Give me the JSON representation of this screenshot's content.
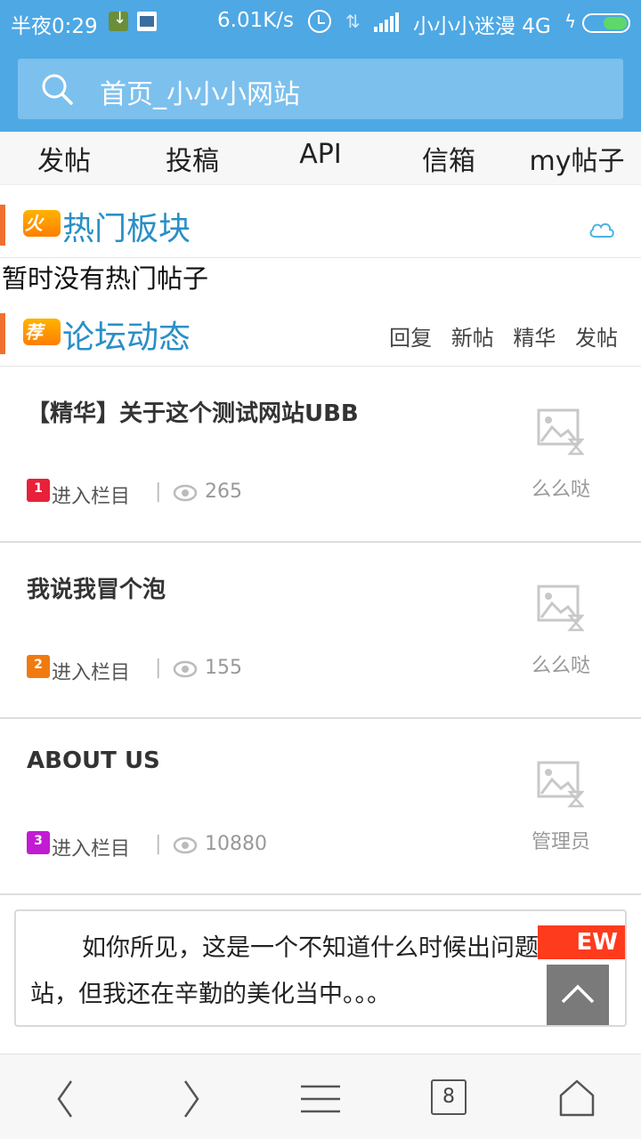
{
  "status_bar": {
    "time": "半夜0:29",
    "speed": "6.01K/s",
    "carrier": "小小小迷漫 4G"
  },
  "search": {
    "text": "首页_小小小网站"
  },
  "nav": [
    {
      "label": "发帖"
    },
    {
      "label": "投稿"
    },
    {
      "label": "API"
    },
    {
      "label": "信箱"
    },
    {
      "label": "my帖子"
    }
  ],
  "hot_section": {
    "badge": "火",
    "title": "热门板块",
    "empty_note": "暂时没有热门帖子"
  },
  "forum_section": {
    "badge": "荐",
    "title": "论坛动态",
    "links": [
      "回复",
      "新帖",
      "精华",
      "发帖"
    ]
  },
  "posts": [
    {
      "title": "【精华】关于这个测试网站UBB",
      "rank": "1",
      "rank_color": "#e8203a",
      "category": "进入栏目",
      "separator": "|",
      "views": "265",
      "author": "么么哒"
    },
    {
      "title": "我说我冒个泡",
      "rank": "2",
      "rank_color": "#f07a10",
      "category": "进入栏目",
      "separator": "|",
      "views": "155",
      "author": "么么哒"
    },
    {
      "title": "ABOUT US",
      "rank": "3",
      "rank_color": "#c21bd4",
      "category": "进入栏目",
      "separator": "|",
      "views": "10880",
      "author": "管理员"
    }
  ],
  "notice": {
    "text": "如你所见，这是一个不知道什么时候出问题的网站，但我还在辛勤的美化当中。。。",
    "badge": "EW"
  },
  "bottom_bar": {
    "tab_count": "8"
  },
  "colors": {
    "primary": "#4ea8e4",
    "section_title": "#2a8fc6",
    "section_bar": "#f07030",
    "new_badge": "#ff3b1d"
  }
}
